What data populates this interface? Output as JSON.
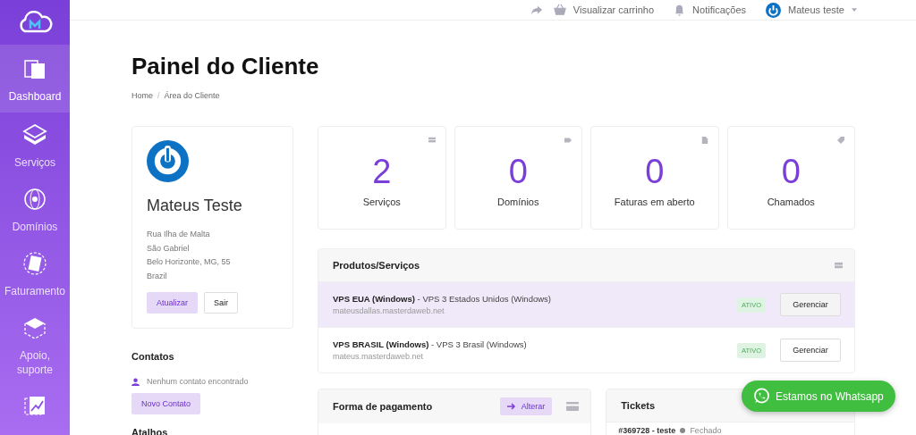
{
  "topbar": {
    "cart_link": "Visualizar carrinho",
    "notifications": "Notificações",
    "user": "Mateus teste"
  },
  "sidebar": {
    "items": [
      {
        "label": "Dashboard",
        "selected": true
      },
      {
        "label": "Serviços",
        "selected": false
      },
      {
        "label": "Domínios",
        "selected": false
      },
      {
        "label": "Faturamento",
        "selected": false
      },
      {
        "label": "Apoio, suporte",
        "selected": false
      },
      {
        "selected": false
      }
    ]
  },
  "page": {
    "title": "Painel do Cliente",
    "breadcrumb": [
      "Home",
      "Área do Cliente"
    ],
    "breadcrumb_separator": "/"
  },
  "profile": {
    "name": "Mateus Teste",
    "address_lines": [
      "Rua Ilha de Malta",
      "São Gabriel",
      "Belo Horizonte, MG, 55",
      "Brazil"
    ],
    "primary_button": "Atualizar",
    "secondary_button": "Sair"
  },
  "contacts": {
    "title": "Contatos",
    "empty_text": "Nenhum contato encontrado",
    "button": "Novo Contato"
  },
  "shortcuts": {
    "title": "Atalhos"
  },
  "stats": [
    {
      "value": "2",
      "label": "Serviços"
    },
    {
      "value": "0",
      "label": "Domínios"
    },
    {
      "value": "0",
      "label": "Faturas em aberto"
    },
    {
      "value": "0",
      "label": "Chamados"
    }
  ],
  "products": {
    "title": "Produtos/Serviços",
    "rows": [
      {
        "title": "**VPS EUA (Windows)** - VPS 3 Estados Unidos (Windows)",
        "domain": "mateusdallas.masterdaweb.net",
        "status": "ATIVO",
        "button": "Gerenciar",
        "hovered": true
      },
      {
        "title": "**VPS BRASIL (Windows)** - VPS 3 Brasil (Windows)",
        "domain": "mateus.masterdaweb.net",
        "status": "ATIVO",
        "button": "Gerenciar",
        "hovered": false
      }
    ]
  },
  "payment": {
    "title": "Forma de pagamento",
    "button": "Alterar"
  },
  "tickets": {
    "title": "Tickets",
    "rows": [
      {
        "title": "#369728 - teste",
        "status": "Fechado"
      }
    ]
  },
  "whatsapp": {
    "label": "Estamos no Whatsapp"
  }
}
